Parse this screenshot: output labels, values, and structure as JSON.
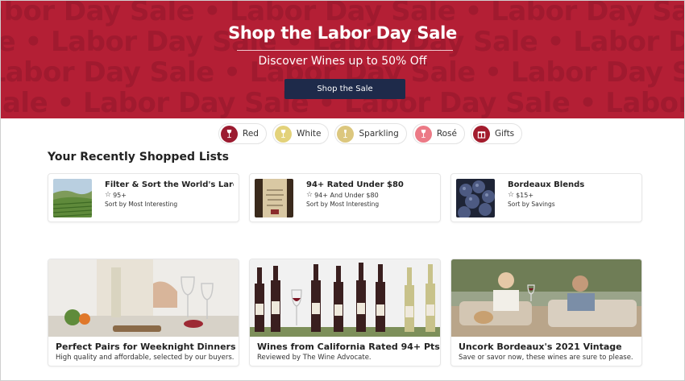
{
  "hero": {
    "background_pattern": [
      "Labor Day Sale • Labor Day Sale • Labor Day Sale • Labor Day Sale",
      "Sale • Labor Day Sale • Labor Day Sale • Labor Day Sale • Labor Day",
      "• Labor Day Sale • Labor Day Sale • Labor Day Sale • Labor Day Sale"
    ],
    "title": "Shop the Labor Day Sale",
    "subtitle": "Discover Wines up to 50% Off",
    "button_label": "Shop the Sale",
    "background_color": "#b41f35",
    "button_color": "#1e2a4a"
  },
  "categories": [
    {
      "label": "Red",
      "icon": "red-wine-icon",
      "color": "#9b1b30"
    },
    {
      "label": "White",
      "icon": "white-wine-icon",
      "color": "#e3d27a"
    },
    {
      "label": "Sparkling",
      "icon": "sparkling-wine-icon",
      "color": "#dcc77e"
    },
    {
      "label": "Rosé",
      "icon": "rose-wine-icon",
      "color": "#ec7a86"
    },
    {
      "label": "Gifts",
      "icon": "gift-icon",
      "color": "#a31c2d"
    }
  ],
  "recent": {
    "title": "Your Recently Shopped Lists",
    "lists": [
      {
        "title": "Filter & Sort the World's Largest...",
        "rating": "95+",
        "sort": "Sort by Most Interesting"
      },
      {
        "title": "94+ Rated Under $80",
        "rating": "94+ And Under $80",
        "sort": "Sort by Most Interesting"
      },
      {
        "title": "Bordeaux Blends",
        "rating": "$15+",
        "sort": "Sort by Savings"
      }
    ]
  },
  "features": [
    {
      "title": "Perfect Pairs for Weeknight Dinners",
      "subtitle": "High quality and affordable, selected by our buyers."
    },
    {
      "title": "Wines from California Rated 94+ Pts",
      "subtitle": "Reviewed by The Wine Advocate."
    },
    {
      "title": "Uncork Bordeaux's 2021 Vintage",
      "subtitle": "Save or savor now, these wines are sure to please."
    }
  ]
}
